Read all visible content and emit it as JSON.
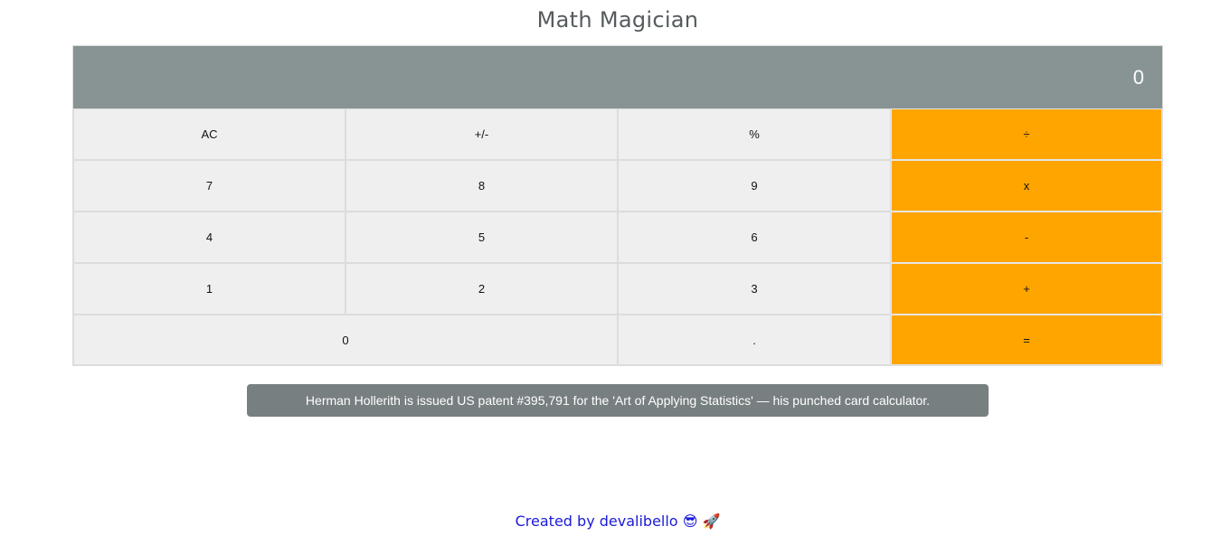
{
  "header": {
    "title": "Math Magician"
  },
  "display": {
    "value": "0"
  },
  "keypad": {
    "rows": [
      [
        "AC",
        "+/-",
        "%",
        "÷"
      ],
      [
        "7",
        "8",
        "9",
        "x"
      ],
      [
        "4",
        "5",
        "6",
        "-"
      ],
      [
        "1",
        "2",
        "3",
        "+"
      ],
      [
        "0",
        ".",
        "="
      ]
    ]
  },
  "fact": {
    "text": "Herman Hollerith is issued US patent #395,791 for the 'Art of Applying Statistics' — his punched card calculator."
  },
  "footer": {
    "prefix": "Created by",
    "author": "devalibello",
    "emojis": "😎 🚀"
  },
  "colors": {
    "display_bg": "#889394",
    "operator_bg": "#ffa500",
    "key_bg": "#efefef",
    "fact_bg": "#787f81",
    "link": "#1a1adb"
  }
}
